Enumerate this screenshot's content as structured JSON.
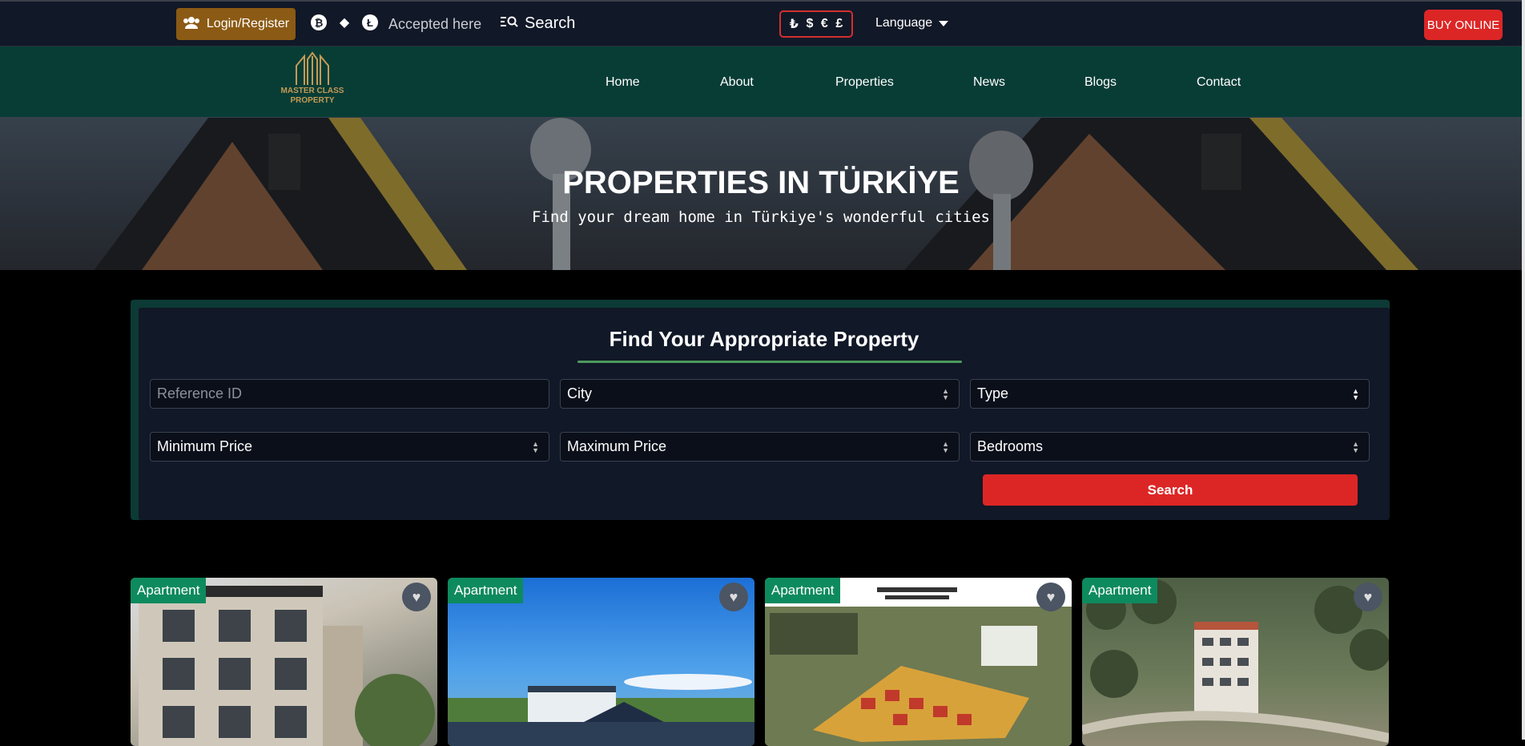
{
  "topbar": {
    "login_label": "Login/Register",
    "crypto": [
      {
        "icon": "bitcoin-icon",
        "glyph": "₿"
      },
      {
        "icon": "ethereum-icon",
        "glyph": "◆"
      },
      {
        "icon": "litecoin-icon",
        "glyph": "Ł"
      }
    ],
    "accepted_label": "Accepted here",
    "search_label": "Search",
    "currencies": [
      "₺",
      "$",
      "€",
      "£"
    ],
    "language_label": "Language",
    "buy_label": "BUY ONLINE"
  },
  "nav": {
    "logo_line1": "MASTER CLASS",
    "logo_line2": "PROPERTY",
    "items": [
      "Home",
      "About",
      "Properties",
      "News",
      "Blogs",
      "Contact"
    ]
  },
  "hero": {
    "title": "PROPERTIES IN TÜRKİYE",
    "subtitle": "Find your dream home in Türkiye's wonderful cities"
  },
  "search_form": {
    "title": "Find Your Appropriate Property",
    "reference_placeholder": "Reference ID",
    "city": "City",
    "type": "Type",
    "min_price": "Minimum Price",
    "max_price": "Maximum Price",
    "bedrooms": "Bedrooms",
    "search_label": "Search"
  },
  "listings": [
    {
      "badge": "Apartment"
    },
    {
      "badge": "Apartment"
    },
    {
      "badge": "Apartment"
    },
    {
      "badge": "Apartment"
    }
  ],
  "colors": {
    "topbar": "#111827",
    "navbar": "#083d36",
    "accent_red": "#dc2626",
    "login_brown": "#8b5a14",
    "badge_green": "#0e8a5f"
  }
}
